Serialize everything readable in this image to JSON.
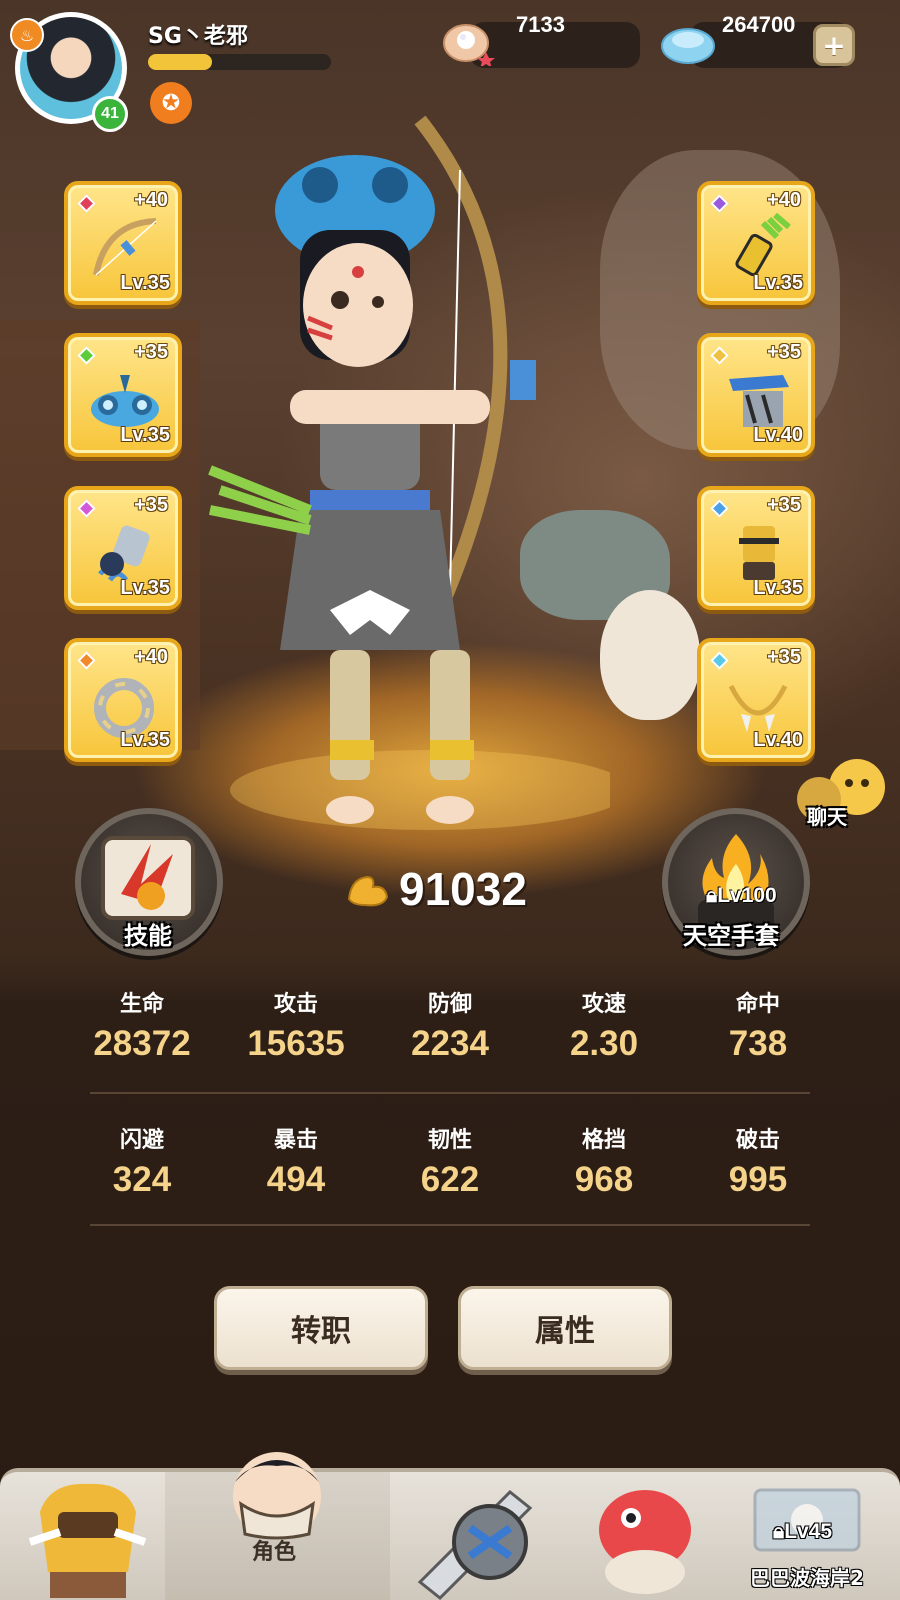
{
  "header": {
    "player_name": "SG丶老邪",
    "player_level": "41",
    "xp_fraction": 0.35,
    "shells": "7133",
    "gems": "264700",
    "plus_symbol": "+"
  },
  "equipment_left": [
    {
      "item": "bow",
      "plus": "+40",
      "level": "Lv.35",
      "gem_color": "#e0405a"
    },
    {
      "item": "frog-helmet",
      "plus": "+35",
      "level": "Lv.35",
      "gem_color": "#5ecb3a"
    },
    {
      "item": "claw-gauntlet",
      "plus": "+35",
      "level": "Lv.35",
      "gem_color": "#d05ad8"
    },
    {
      "item": "stone-ring",
      "plus": "+40",
      "level": "Lv.35",
      "gem_color": "#f08a2a"
    }
  ],
  "equipment_right": [
    {
      "item": "arrow-quiver",
      "plus": "+40",
      "level": "Lv.35",
      "gem_color": "#9a5ae0"
    },
    {
      "item": "armor-chest",
      "plus": "+35",
      "level": "Lv.40",
      "gem_color": "#f0c040"
    },
    {
      "item": "boots",
      "plus": "+35",
      "level": "Lv.35",
      "gem_color": "#4aa0e8"
    },
    {
      "item": "tooth-necklace",
      "plus": "+35",
      "level": "Lv.40",
      "gem_color": "#5ac8e8"
    }
  ],
  "skill_button": {
    "label": "技能"
  },
  "combat_power": "91032",
  "weapon_button": {
    "lock_level": "Lv100",
    "label": "天空手套"
  },
  "chat": {
    "label": "聊天"
  },
  "stats_row1": [
    {
      "name": "生命",
      "value": "28372"
    },
    {
      "name": "攻击",
      "value": "15635"
    },
    {
      "name": "防御",
      "value": "2234"
    },
    {
      "name": "攻速",
      "value": "2.30"
    },
    {
      "name": "命中",
      "value": "738"
    }
  ],
  "stats_row2": [
    {
      "name": "闪避",
      "value": "324"
    },
    {
      "name": "暴击",
      "value": "494"
    },
    {
      "name": "韧性",
      "value": "622"
    },
    {
      "name": "格挡",
      "value": "968"
    },
    {
      "name": "破击",
      "value": "995"
    }
  ],
  "actions": {
    "job_change": "转职",
    "attributes": "属性"
  },
  "nav": {
    "tabs": [
      {
        "icon": "beast-mask-icon",
        "label": ""
      },
      {
        "icon": "character-icon",
        "label": "角色",
        "active": true
      },
      {
        "icon": "weapon-icon",
        "label": ""
      },
      {
        "icon": "pet-icon",
        "label": ""
      },
      {
        "icon": "map-scroll-icon",
        "label": ""
      }
    ],
    "stage_lock_level": "Lv45",
    "stage_name": "巴巴波海岸2"
  }
}
